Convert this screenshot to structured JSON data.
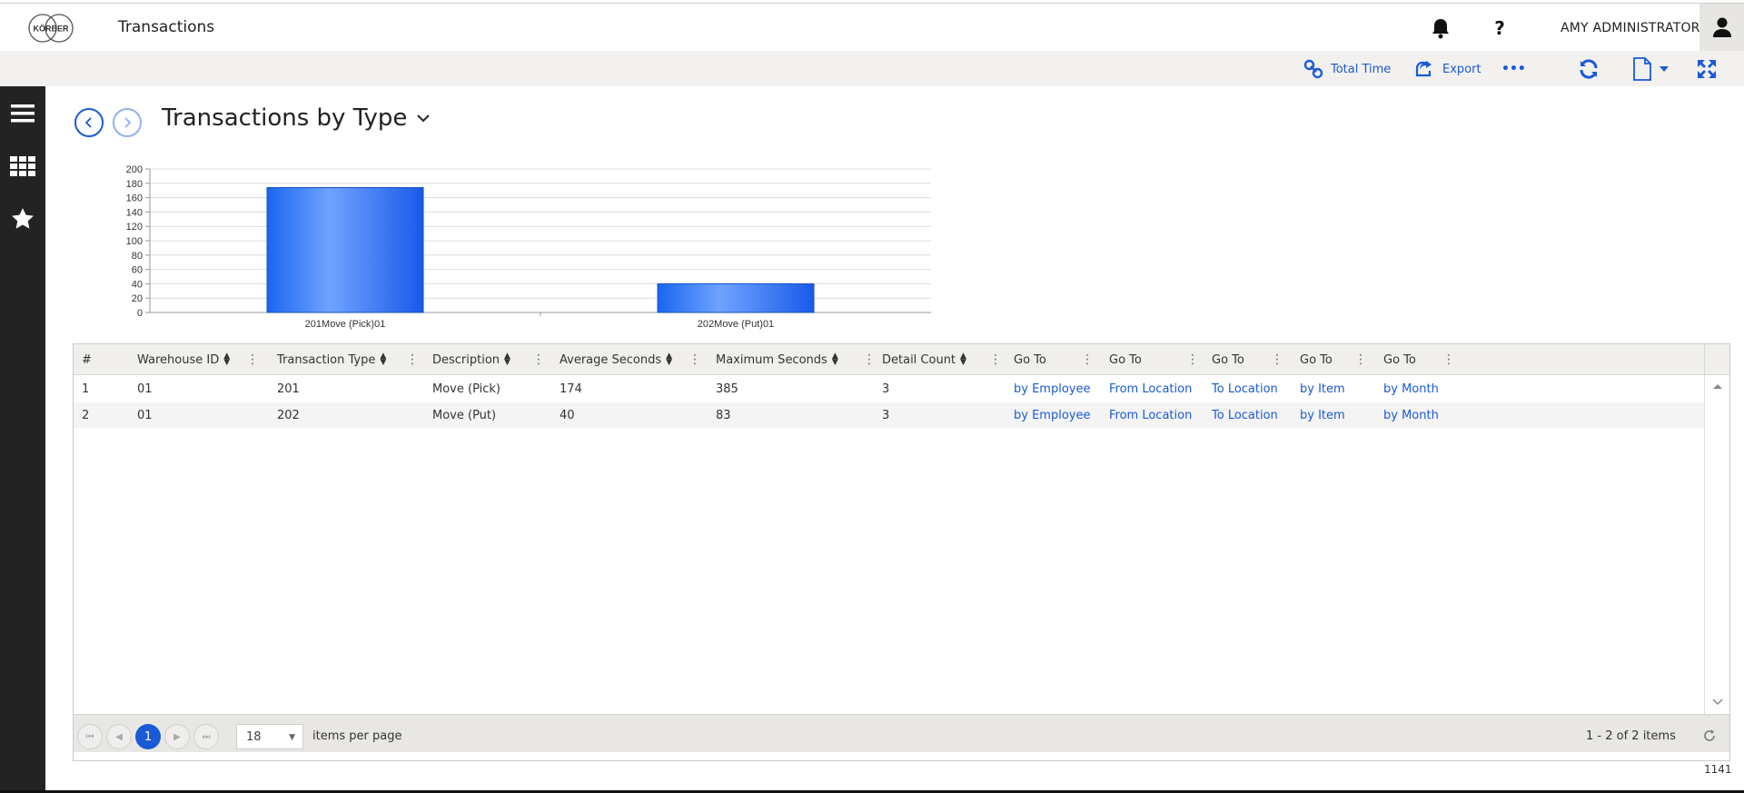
{
  "header": {
    "logo_text": "KÖRBER",
    "title": "Transactions",
    "user_name": "AMY ADMINISTRATOR",
    "help_label": "?"
  },
  "toolbar": {
    "total_time_label": "Total Time",
    "export_label": "Export",
    "more_label": "•••"
  },
  "page": {
    "title": "Transactions by Type"
  },
  "chart_data": {
    "type": "bar",
    "categories": [
      "201Move (Pick)01",
      "202Move (Put)01"
    ],
    "values": [
      174,
      40
    ],
    "title": "",
    "xlabel": "",
    "ylabel": "",
    "ylim": [
      0,
      200
    ],
    "yticks": [
      0,
      20,
      40,
      60,
      80,
      100,
      120,
      140,
      160,
      180,
      200
    ],
    "grid": true,
    "colors": {
      "bar": "#1a66f0",
      "bar_highlight": "#6fa3ff"
    }
  },
  "grid": {
    "columns": [
      "#",
      "Warehouse ID",
      "Transaction Type",
      "Description",
      "Average Seconds",
      "Maximum Seconds",
      "Detail Count",
      "Go To",
      "Go To",
      "Go To",
      "Go To",
      "Go To"
    ],
    "rows": [
      [
        "1",
        "01",
        "201",
        "Move (Pick)",
        "174",
        "385",
        "3",
        "by Employee",
        "From Location",
        "To Location",
        "by Item",
        "by Month"
      ],
      [
        "2",
        "01",
        "202",
        "Move (Put)",
        "40",
        "83",
        "3",
        "by Employee",
        "From Location",
        "To Location",
        "by Item",
        "by Month"
      ]
    ]
  },
  "pager": {
    "current_page": "1",
    "page_size": "18",
    "items_per_page_label": "items per page",
    "info": "1 - 2 of 2 items"
  },
  "footer": {
    "number": "1141"
  },
  "colors": {
    "accent": "#1a5ad6",
    "sidebar": "#232323",
    "toolbar_bg": "#f2f1ef"
  }
}
